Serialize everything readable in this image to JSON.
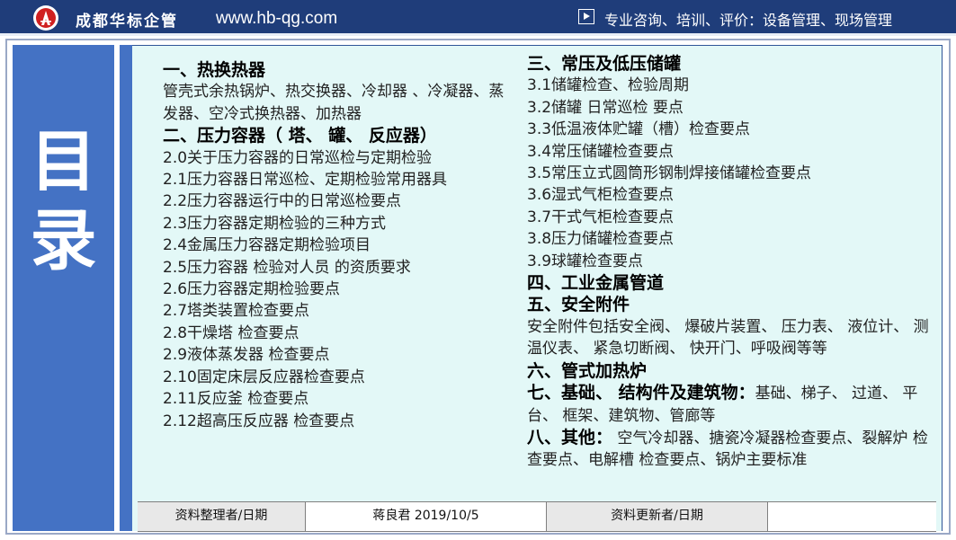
{
  "header": {
    "company": "成都华标企管",
    "website": "www.hb-qg.com",
    "tagline": "专业咨询、培训、评价：设备管理、现场管理",
    "colors": {
      "bar": "#1f3d7a",
      "accent": "#4472c4",
      "content_bg": "#e3f8f7"
    }
  },
  "sidebar": {
    "title_1": "目",
    "title_2": "录"
  },
  "left_column": [
    {
      "type": "heading",
      "text": "一、热换热器"
    },
    {
      "type": "text",
      "text": "管壳式余热锅炉、热交换器、冷却器 、冷凝器、蒸发器、空冷式换热器、加热器"
    },
    {
      "type": "heading",
      "text": "二、压力容器（ 塔、  罐、  反应器）"
    },
    {
      "type": "item",
      "text": "2.0关于压力容器的日常巡检与定期检验"
    },
    {
      "type": "item",
      "text": "2.1压力容器日常巡检、定期检验常用器具"
    },
    {
      "type": "item",
      "text": "2.2压力容器运行中的日常巡检要点"
    },
    {
      "type": "item",
      "text": "2.3压力容器定期检验的三种方式"
    },
    {
      "type": "item",
      "text": "2.4金属压力容器定期检验项目"
    },
    {
      "type": "item",
      "text": "2.5压力容器 检验对人员 的资质要求"
    },
    {
      "type": "item",
      "text": "2.6压力容器定期检验要点"
    },
    {
      "type": "item",
      "text": "2.7塔类装置检查要点"
    },
    {
      "type": "item",
      "text": "2.8干燥塔 检查要点"
    },
    {
      "type": "item",
      "text": "2.9液体蒸发器 检查要点"
    },
    {
      "type": "item",
      "text": "2.10固定床层反应器检查要点"
    },
    {
      "type": "item",
      "text": "2.11反应釜 检查要点"
    },
    {
      "type": "item",
      "text": "2.12超高压反应器 检查要点"
    }
  ],
  "right_column": {
    "section3": "三、常压及低压储罐",
    "section3_items": [
      "3.1储罐检查、检验周期",
      "3.2储罐 日常巡检 要点",
      "3.3低温液体贮罐（槽）检查要点",
      "3.4常压储罐检查要点",
      "3.5常压立式圆筒形钢制焊接储罐检查要点",
      "3.6湿式气柜检查要点",
      "3.7干式气柜检查要点",
      "3.8压力储罐检查要点",
      "3.9球罐检查要点"
    ],
    "section4": "四、工业金属管道",
    "section5": "五、安全附件",
    "section5_text": "安全附件包括安全阀、 爆破片装置、 压力表、 液位计、 测温仪表、 紧急切断阀、 快开门、呼吸阀等等",
    "section6": "六、管式加热炉",
    "section7": "七、基础、 结构件及建筑物：",
    "section7_text": "基础、梯子、 过道、 平台、 框架、建筑物、管廊等",
    "section8": "八、其他：",
    "section8_text": " 空气冷却器、搪瓷冷凝器检查要点、裂解炉 检查要点、电解槽 检查要点、锅炉主要标准"
  },
  "footer": {
    "organizer_label": "资料整理者/日期",
    "organizer_value": "蒋良君   2019/10/5",
    "updater_label": "资料更新者/日期",
    "updater_value": ""
  }
}
